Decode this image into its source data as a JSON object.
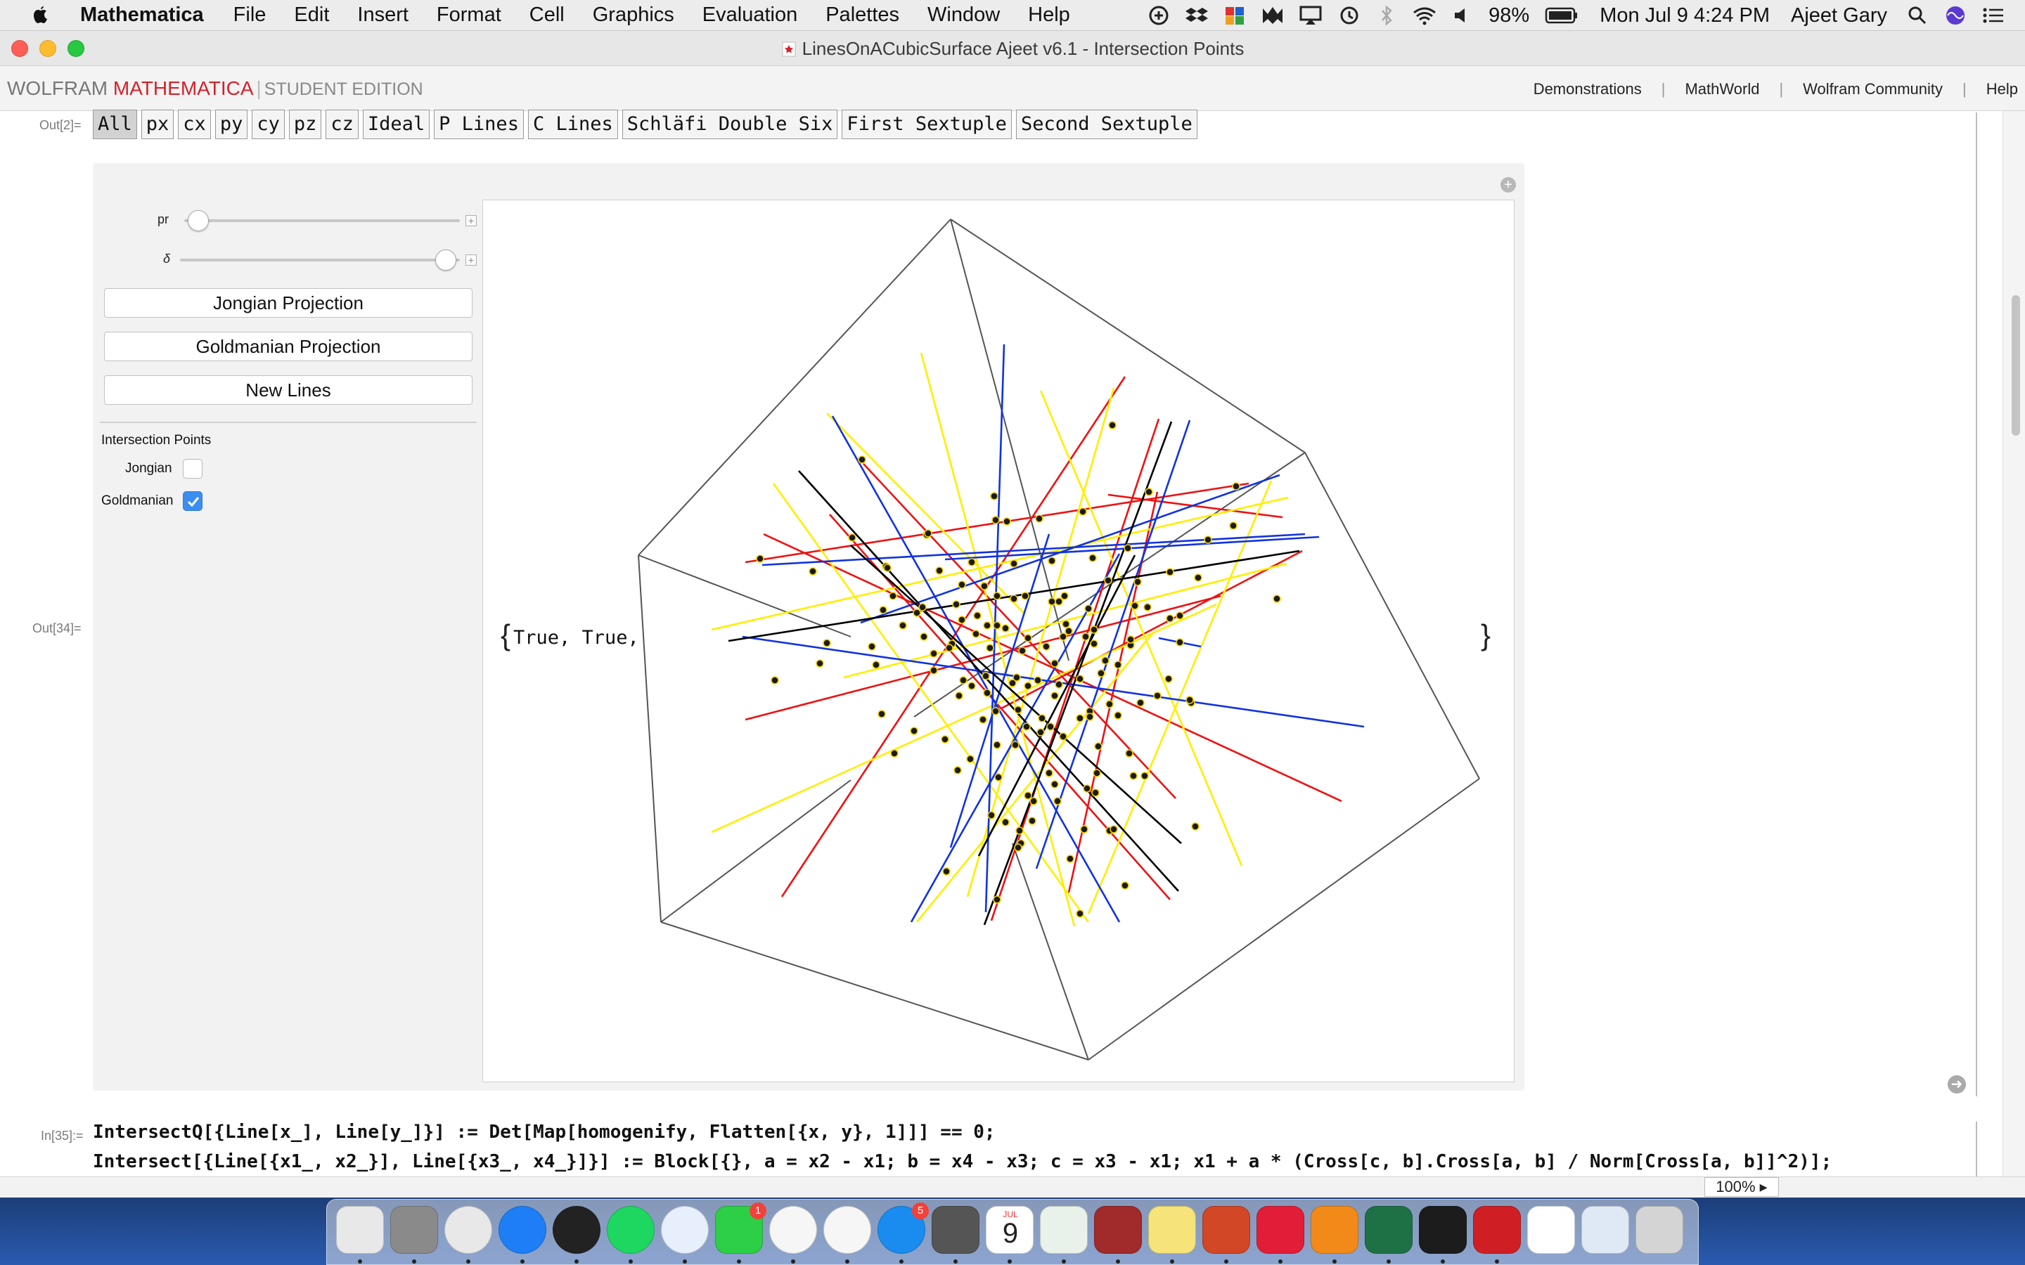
{
  "menubar": {
    "app_name": "Mathematica",
    "items": [
      "File",
      "Edit",
      "Insert",
      "Format",
      "Cell",
      "Graphics",
      "Evaluation",
      "Palettes",
      "Window",
      "Help"
    ],
    "battery": "98%",
    "datetime": "Mon Jul 9  4:24 PM",
    "user": "Ajeet Gary"
  },
  "window": {
    "title": "LinesOnACubicSurface Ajeet v6.1 - Intersection Points"
  },
  "wolfram_bar": {
    "brand_wolfram": "WOLFRAM",
    "brand_mathematica": "MATHEMATICA",
    "brand_separator": "|",
    "edition": "STUDENT EDITION",
    "links": [
      "Demonstrations",
      "MathWorld",
      "Wolfram Community",
      "Help"
    ],
    "link_separator": "|"
  },
  "notebook": {
    "out2_label": "Out[2]=",
    "setter_buttons": [
      "All",
      "px",
      "cx",
      "py",
      "cy",
      "pz",
      "cz",
      "Ideal",
      "P Lines",
      "C Lines",
      "Schläfi Double Six",
      "First Sextuple",
      "Second Sextuple"
    ],
    "active_setter": "All",
    "out34_label": "Out[34]=",
    "output_prefix": "True, True,",
    "in35_label": "In[35]:=",
    "code_lines": [
      "IntersectQ[{Line[x_], Line[y_]}] := Det[Map[homogenify, Flatten[{x, y}, 1]]] == 0;",
      "Intersect[{Line[{x1_, x2_}], Line[{x3_, x4_}]}] := Block[{}, a = x2 - x1; b = x4 - x3; c = x3 - x1; x1 + a * (Cross[c, b].Cross[a, b] / Norm[Cross[a, b]]^2)];"
    ],
    "zoom": "100%"
  },
  "manipulate": {
    "sliders": [
      {
        "label": "pr",
        "value": 0.05
      },
      {
        "label": "δ",
        "value": 0.95
      }
    ],
    "buttons": [
      "Jongian Projection",
      "Goldmanian Projection",
      "New Lines"
    ],
    "section_label": "Intersection Points",
    "checkboxes": [
      {
        "label": "Jongian",
        "checked": false
      },
      {
        "label": "Goldmanian",
        "checked": true
      }
    ]
  },
  "colors": {
    "red_lines": "#ee1111",
    "yellow_lines": "#ffee00",
    "blue_lines": "#1133dd",
    "black_lines": "#000000",
    "checkbox_blue": "#3b8ef0",
    "brand_red": "#d0232b"
  },
  "dock_icons": [
    "finder-icon",
    "system-preferences-icon",
    "chrome-icon",
    "safari-icon",
    "siri-icon",
    "spotify-icon",
    "messages-icon",
    "facetime-icon",
    "photos-icon",
    "itunes-icon",
    "app-store-icon",
    "calculator-icon",
    "calendar-icon",
    "maps-icon",
    "photo-booth-icon",
    "notes-icon",
    "powerpoint-icon",
    "f5-icon",
    "sublime-icon",
    "excel-icon",
    "terminal-icon",
    "mathematica-icon",
    "ccv-icon",
    "preview-icon",
    "trash-icon"
  ],
  "dock_badges": {
    "facetime": "1",
    "app_store": "5"
  },
  "calendar_day": "9",
  "calendar_month": "JUL"
}
